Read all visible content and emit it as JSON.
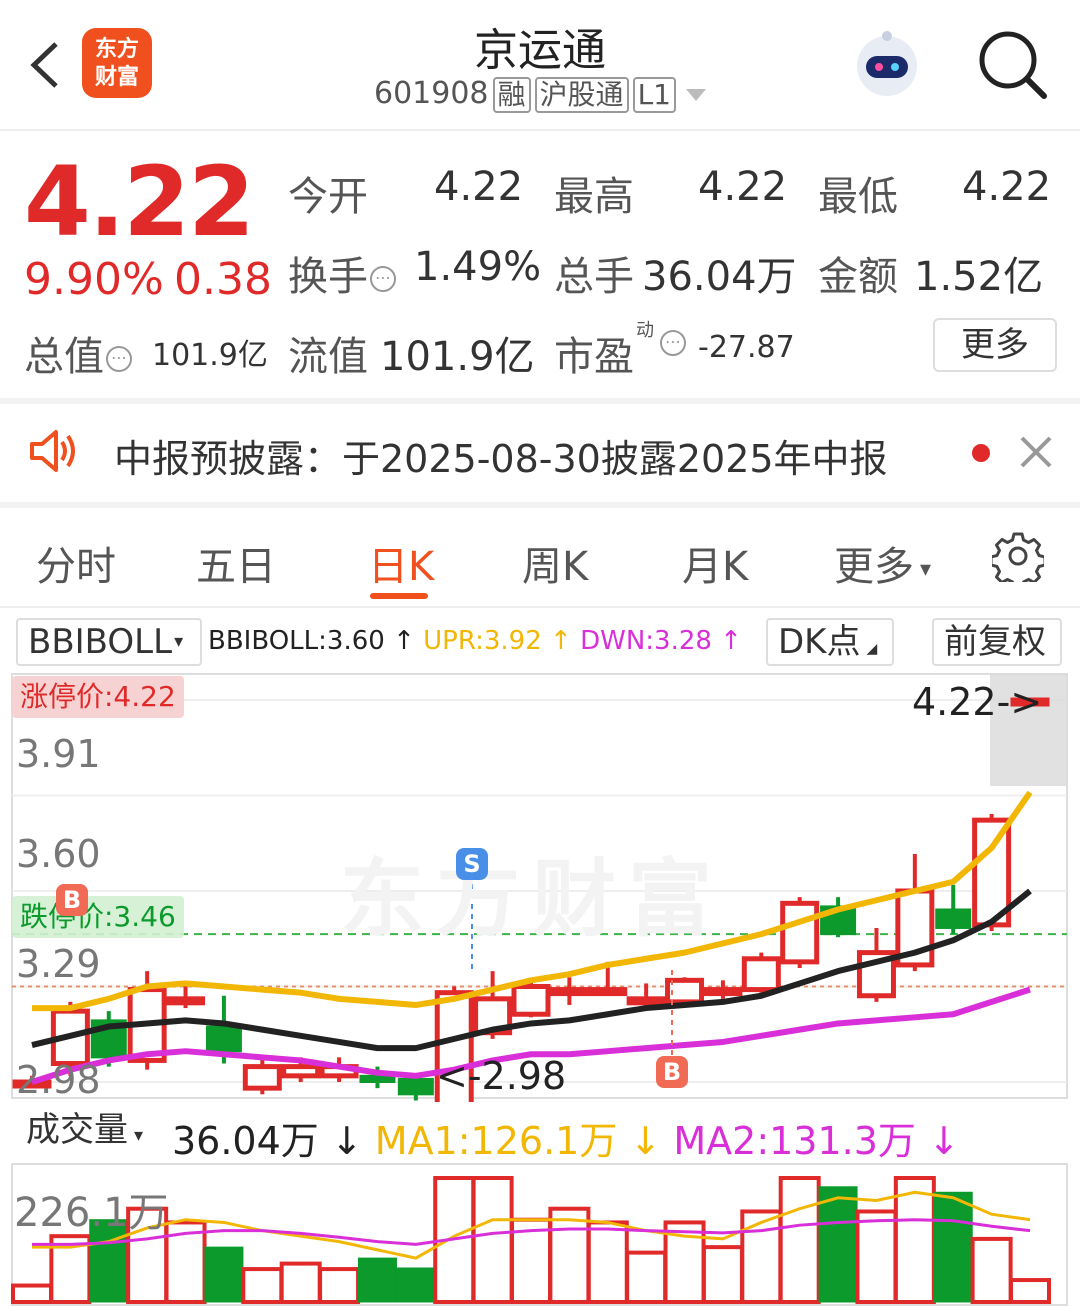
{
  "header": {
    "title": "京运通",
    "code": "601908",
    "tags": [
      "融",
      "沪股通",
      "L1"
    ],
    "logo_text": "东方\n财富"
  },
  "quote": {
    "price": "4.22",
    "change_pct": "9.90%",
    "change": "0.38",
    "open_label": "今开",
    "open": "4.22",
    "high_label": "最高",
    "high": "4.22",
    "low_label": "最低",
    "low": "4.22",
    "turnover_label": "换手",
    "turnover": "1.49%",
    "volume_label": "总手",
    "volume": "36.04万",
    "amount_label": "金额",
    "amount": "1.52亿",
    "mktcap_label": "总值",
    "mktcap": "101.9亿",
    "float_label": "流值",
    "float": "101.9亿",
    "pe_label": "市盈",
    "pe_sup": "动",
    "pe": "-27.87",
    "more_label": "更多"
  },
  "notice": {
    "text": "中报预披露：于2025-08-30披露2025年中报"
  },
  "tabs": [
    "分时",
    "五日",
    "日K",
    "周K",
    "月K",
    "更多"
  ],
  "active_tab": "日K",
  "indicator": {
    "name": "BBIBOLL",
    "bbiboll": "BBIBOLL:3.60",
    "upr": "UPR:3.92",
    "dwn": "DWN:3.28",
    "dk_label": "DK点",
    "adj_label": "前复权"
  },
  "price_chart": {
    "labels": [
      "4.22",
      "3.91",
      "3.60",
      "3.29",
      "2.98"
    ],
    "limit_up": "涨停价:4.22",
    "limit_down": "跌停价:3.46",
    "last": "4.22->",
    "low_mark": "<-2.98",
    "watermark": "东方财富",
    "s_badge": "S",
    "b_badge": "B"
  },
  "volume_bar": {
    "label": "成交量",
    "vol": "36.04万",
    "ma1": "MA1:126.1万",
    "ma2": "MA2:131.3万",
    "max_label": "226.1万"
  },
  "colors": {
    "up": "#e02a2a",
    "down": "#0b9a2b",
    "bbi": "#222222",
    "upr": "#f2b705",
    "dwn": "#d92fd9",
    "accent": "#f0501e"
  },
  "chart_data": {
    "type": "candlestick",
    "y_ticks": [
      4.22,
      3.91,
      3.6,
      3.29,
      2.98
    ],
    "candles": [
      {
        "o": 2.98,
        "c": 2.98,
        "h": 3.0,
        "l": 2.96
      },
      {
        "o": 3.04,
        "c": 3.21,
        "h": 3.24,
        "l": 3.0
      },
      {
        "o": 3.18,
        "c": 3.06,
        "h": 3.21,
        "l": 3.03
      },
      {
        "o": 3.05,
        "c": 3.28,
        "h": 3.34,
        "l": 3.02
      },
      {
        "o": 3.25,
        "c": 3.25,
        "h": 3.29,
        "l": 3.22
      },
      {
        "o": 3.16,
        "c": 3.08,
        "h": 3.26,
        "l": 3.04
      },
      {
        "o": 2.96,
        "c": 3.03,
        "h": 3.06,
        "l": 2.94
      },
      {
        "o": 3.0,
        "c": 3.03,
        "h": 3.06,
        "l": 2.98
      },
      {
        "o": 3.0,
        "c": 3.03,
        "h": 3.06,
        "l": 2.98
      },
      {
        "o": 3.0,
        "c": 2.98,
        "h": 3.03,
        "l": 2.96
      },
      {
        "o": 2.99,
        "c": 2.94,
        "h": 3.0,
        "l": 2.92
      },
      {
        "o": 2.9,
        "c": 3.27,
        "h": 3.29,
        "l": 2.88
      },
      {
        "o": 3.14,
        "c": 3.25,
        "h": 3.34,
        "l": 3.12
      },
      {
        "o": 3.2,
        "c": 3.29,
        "h": 3.31,
        "l": 3.19
      },
      {
        "o": 3.28,
        "c": 3.28,
        "h": 3.32,
        "l": 3.23
      },
      {
        "o": 3.28,
        "c": 3.28,
        "h": 3.37,
        "l": 3.27
      },
      {
        "o": 3.24,
        "c": 3.25,
        "h": 3.3,
        "l": 3.22
      },
      {
        "o": 3.24,
        "c": 3.31,
        "h": 3.32,
        "l": 3.24
      },
      {
        "o": 3.28,
        "c": 3.28,
        "h": 3.31,
        "l": 3.25
      },
      {
        "o": 3.28,
        "c": 3.38,
        "h": 3.4,
        "l": 3.27
      },
      {
        "o": 3.37,
        "c": 3.56,
        "h": 3.58,
        "l": 3.35
      },
      {
        "o": 3.55,
        "c": 3.46,
        "h": 3.58,
        "l": 3.45
      },
      {
        "o": 3.26,
        "c": 3.4,
        "h": 3.48,
        "l": 3.24
      },
      {
        "o": 3.36,
        "c": 3.6,
        "h": 3.72,
        "l": 3.34
      },
      {
        "o": 3.54,
        "c": 3.48,
        "h": 3.62,
        "l": 3.46
      },
      {
        "o": 3.49,
        "c": 3.83,
        "h": 3.85,
        "l": 3.47
      },
      {
        "o": 4.22,
        "c": 4.22,
        "h": 4.22,
        "l": 4.22
      }
    ],
    "bbi": [
      3.1,
      3.13,
      3.16,
      3.17,
      3.18,
      3.17,
      3.15,
      3.13,
      3.11,
      3.09,
      3.09,
      3.12,
      3.15,
      3.17,
      3.18,
      3.2,
      3.22,
      3.23,
      3.24,
      3.26,
      3.3,
      3.34,
      3.37,
      3.4,
      3.44,
      3.5,
      3.6
    ],
    "upr": [
      3.22,
      3.22,
      3.25,
      3.29,
      3.3,
      3.29,
      3.28,
      3.27,
      3.25,
      3.24,
      3.23,
      3.25,
      3.28,
      3.31,
      3.33,
      3.36,
      3.38,
      3.4,
      3.43,
      3.46,
      3.5,
      3.54,
      3.57,
      3.6,
      3.63,
      3.74,
      3.92
    ],
    "dwn": [
      2.98,
      3.02,
      3.05,
      3.07,
      3.08,
      3.07,
      3.06,
      3.05,
      3.03,
      3.01,
      3.0,
      3.02,
      3.05,
      3.07,
      3.07,
      3.08,
      3.09,
      3.1,
      3.11,
      3.13,
      3.15,
      3.17,
      3.18,
      3.19,
      3.2,
      3.24,
      3.28
    ],
    "volume": [
      30,
      120,
      150,
      170,
      145,
      100,
      60,
      70,
      60,
      80,
      62,
      226,
      226,
      150,
      170,
      145,
      90,
      145,
      100,
      165,
      226,
      210,
      165,
      226,
      200,
      115,
      40
    ],
    "vol_ma1": [
      100,
      100,
      110,
      135,
      150,
      145,
      130,
      120,
      110,
      95,
      80,
      120,
      150,
      150,
      150,
      145,
      130,
      120,
      115,
      145,
      170,
      190,
      185,
      200,
      190,
      160,
      150
    ],
    "vol_ma2": [
      105,
      105,
      108,
      115,
      125,
      130,
      130,
      125,
      118,
      110,
      105,
      115,
      125,
      130,
      133,
      133,
      130,
      128,
      126,
      130,
      140,
      145,
      148,
      150,
      148,
      138,
      130
    ]
  }
}
